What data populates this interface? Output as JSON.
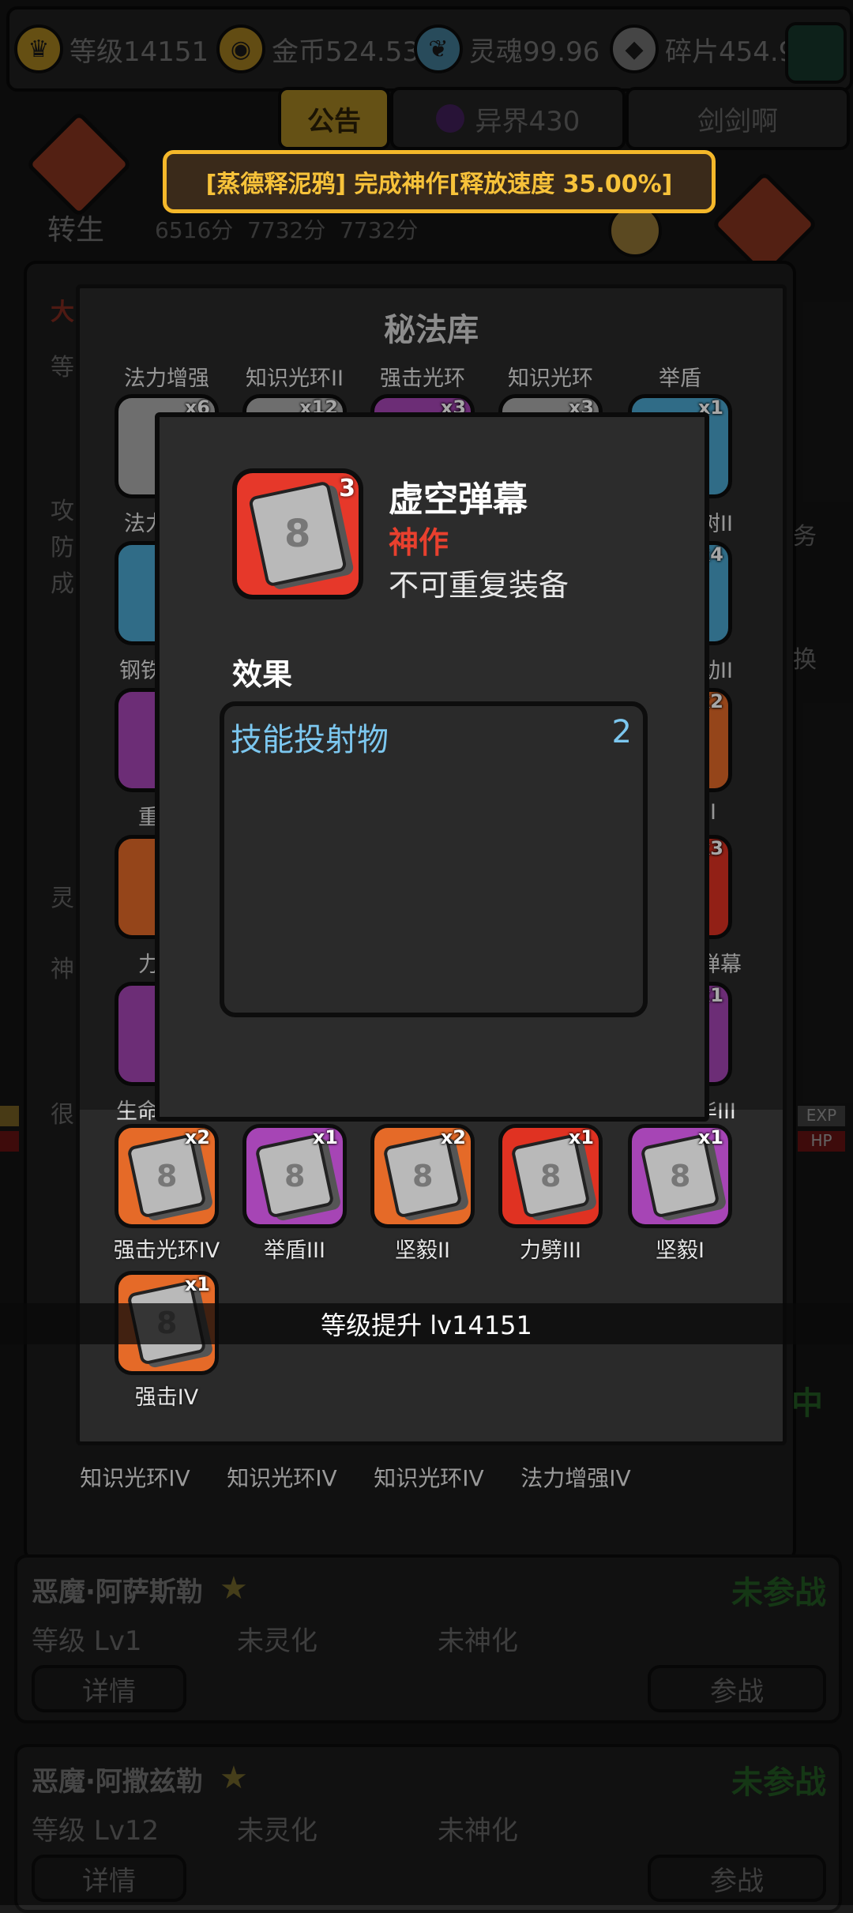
{
  "topbar": {
    "level": "等级14151",
    "gold": "金币524.53",
    "soul": "灵魂99.96",
    "shard": "碎片454.9"
  },
  "tabs": {
    "notice": "公告",
    "other_world": "异界430",
    "sword": "剑剑啊"
  },
  "background": {
    "rebirth": "转生",
    "scores": "6516分  7732分  7732分",
    "left_chars": [
      "大",
      "等",
      "攻",
      "防",
      "成",
      "灵",
      "神",
      "很"
    ],
    "right_chars": [
      "务",
      "换"
    ],
    "badge_zhong": "中",
    "exp": "EXP",
    "hp": "HP"
  },
  "announcement": "[蒸德释泥鸦] 完成神作[释放速度 35.00%]",
  "library": {
    "title": "秘法库",
    "header_labels": [
      "法力增强",
      "知识光环II",
      "强击光环",
      "知识光环",
      "举盾"
    ],
    "top_row_counts": [
      "x6",
      "x12",
      "x3",
      "x3",
      "x1"
    ],
    "side_left_labels": [
      "法力",
      "钢铁",
      "重",
      "力",
      "生命"
    ],
    "side_right_labels": [
      "树II",
      "动II",
      "II",
      "弹幕",
      "华III"
    ],
    "side_right_counts": [
      "x4",
      "x2",
      "x3",
      "x1"
    ],
    "bottom_row": [
      {
        "name": "强击光环IV",
        "count": "x2",
        "color": "orange"
      },
      {
        "name": "举盾III",
        "count": "x1",
        "color": "purple"
      },
      {
        "name": "坚毅II",
        "count": "x2",
        "color": "orange"
      },
      {
        "name": "力劈III",
        "count": "x1",
        "color": "red"
      },
      {
        "name": "坚毅I",
        "count": "x1",
        "color": "purple"
      }
    ],
    "last_item": {
      "name": "强击IV",
      "count": "x1",
      "color": "orange"
    },
    "level_up": "等级提升 lv14151",
    "behind_labels": [
      "知识光环IV",
      "知识光环IV",
      "知识光环IV",
      "法力增强IV"
    ]
  },
  "detail": {
    "count": "3",
    "name": "虚空弹幕",
    "rank": "神作",
    "note": "不可重复装备",
    "effect_label": "效果",
    "effects": [
      {
        "key": "技能投射物",
        "value": "2"
      }
    ]
  },
  "heroes": [
    {
      "name": "恶魔·阿萨斯勒",
      "state": "未参战",
      "level": "等级 Lv1",
      "soul": "未灵化",
      "god": "未神化",
      "detail_btn": "详情",
      "join_btn": "参战"
    },
    {
      "name": "恶魔·阿撒兹勒",
      "state": "未参战",
      "level": "等级 Lv12",
      "soul": "未灵化",
      "god": "未神化",
      "detail_btn": "详情",
      "join_btn": "参战"
    }
  ],
  "colors": {
    "gold_border": "#f5b82a",
    "legendary_red": "#e8402e",
    "effect_blue": "#7cc7ef"
  },
  "icons": [
    "crown-icon",
    "coin-icon",
    "soul-icon",
    "shard-icon",
    "book-icon",
    "star-icon"
  ]
}
